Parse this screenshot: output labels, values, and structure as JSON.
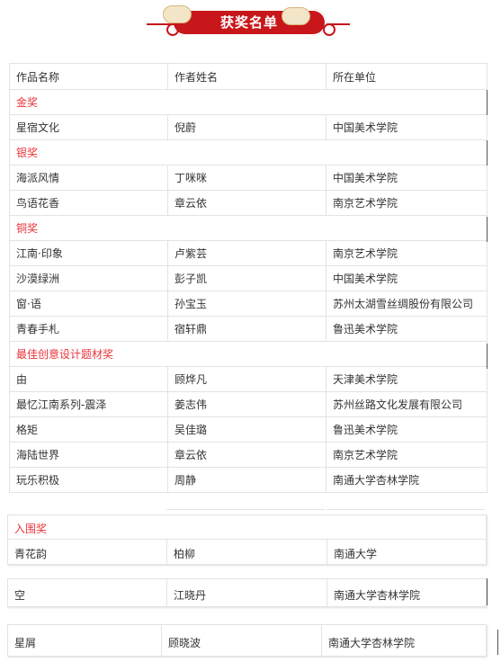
{
  "title": "获奖名单",
  "headers": [
    "作品名称",
    "作者姓名",
    "所在单位"
  ],
  "sections": [
    {
      "label": "金奖",
      "rows": [
        [
          "星宿文化",
          "倪蔚",
          "中国美术学院"
        ]
      ]
    },
    {
      "label": "银奖",
      "rows": [
        [
          "海派风情",
          "丁咪咪",
          "中国美术学院"
        ],
        [
          "鸟语花香",
          "章云依",
          "南京艺术学院"
        ]
      ]
    },
    {
      "label": "铜奖",
      "rows": [
        [
          "江南·印象",
          "卢紫芸",
          "南京艺术学院"
        ],
        [
          "沙漠绿洲",
          "彭子凯",
          "中国美术学院"
        ],
        [
          "窗·语",
          "孙宝玉",
          "苏州太湖雪丝绸股份有限公司"
        ],
        [
          "青春手札",
          "宿轩鼎",
          "鲁迅美术学院"
        ]
      ]
    },
    {
      "label": "最佳创意设计题材奖",
      "rows": [
        [
          "由",
          "顾烨凡",
          "天津美术学院"
        ],
        [
          "最忆江南系列-震泽",
          "姜志伟",
          "苏州丝路文化发展有限公司"
        ],
        [
          "格矩",
          "吴佳璐",
          "鲁迅美术学院"
        ],
        [
          "海陆世界",
          "章云依",
          "南京艺术学院"
        ],
        [
          "玩乐积极",
          "周静",
          "南通大学杏林学院"
        ]
      ]
    }
  ],
  "finalist": {
    "label": "入围奖",
    "rows": [
      [
        "青花韵",
        "柏柳",
        "南通大学"
      ],
      [
        "空",
        "江晓丹",
        "南通大学杏林学院"
      ],
      [
        "星屑",
        "顾晓波",
        "南通大学杏林学院"
      ]
    ]
  },
  "colors": {
    "banner_red": "#c7171b",
    "category_red": "#e8343a"
  }
}
